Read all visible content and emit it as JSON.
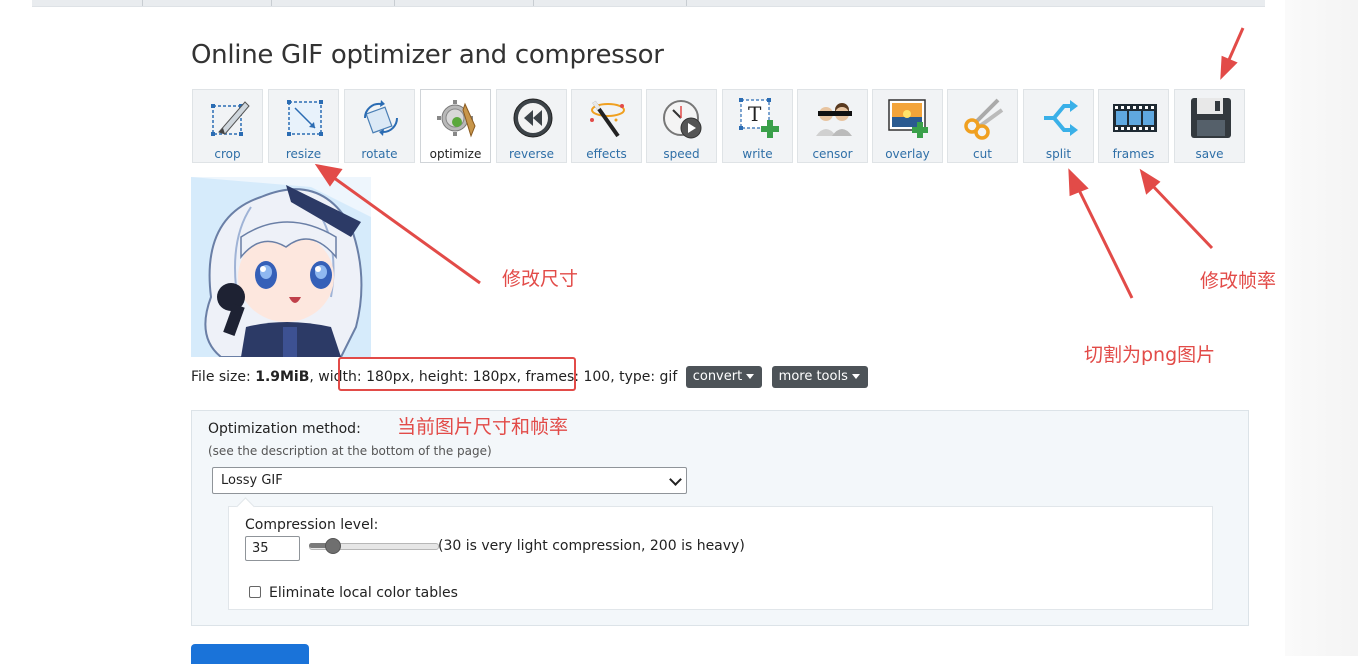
{
  "page": {
    "title": "Online GIF optimizer and compressor"
  },
  "toolbar": {
    "tools": [
      {
        "label": "crop",
        "icon": "crop-icon"
      },
      {
        "label": "resize",
        "icon": "resize-icon"
      },
      {
        "label": "rotate",
        "icon": "rotate-icon"
      },
      {
        "label": "optimize",
        "icon": "optimize-icon",
        "active": true
      },
      {
        "label": "reverse",
        "icon": "reverse-icon"
      },
      {
        "label": "effects",
        "icon": "effects-icon"
      },
      {
        "label": "speed",
        "icon": "speed-icon"
      },
      {
        "label": "write",
        "icon": "write-icon"
      },
      {
        "label": "censor",
        "icon": "censor-icon"
      },
      {
        "label": "overlay",
        "icon": "overlay-icon"
      },
      {
        "label": "cut",
        "icon": "cut-icon"
      },
      {
        "label": "split",
        "icon": "split-icon"
      },
      {
        "label": "frames",
        "icon": "frames-icon"
      },
      {
        "label": "save",
        "icon": "save-icon"
      }
    ]
  },
  "file_info": {
    "size_label": "File size: ",
    "size_value": "1.9MiB",
    "width_label": ", width: ",
    "width_value": "180px",
    "height_label": ", height: ",
    "height_value": "180px",
    "frames_label": ", frames: ",
    "frames_value": "100",
    "type_label": ", type: ",
    "type_value": "gif",
    "convert_button": "convert",
    "more_tools_button": "more tools"
  },
  "optimization": {
    "method_label": "Optimization method:",
    "method_hint": "(see the description at the bottom of the page)",
    "method_selected": "Lossy GIF",
    "compression_label": "Compression level:",
    "compression_value": "35",
    "compression_level": 35,
    "compression_range": [
      30,
      200
    ],
    "compression_note": "(30 is very light compression, 200 is heavy)",
    "eliminate_label": "Eliminate local color tables",
    "eliminate_checked": false
  },
  "annotations": {
    "resize_note": "修改尺寸",
    "current_note": "当前图片尺寸和帧率",
    "split_note": "切割为png图片",
    "frames_note": "修改帧率",
    "color": "#e24b48"
  },
  "colors": {
    "accent_link": "#2f6fa7",
    "dark_button": "#4d5358",
    "primary": "#1a73d9"
  }
}
